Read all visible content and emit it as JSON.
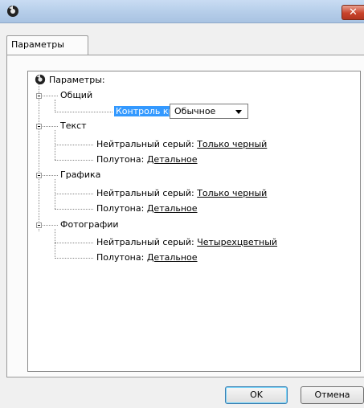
{
  "window": {
    "title": ""
  },
  "tabs": [
    {
      "label": "Параметры"
    }
  ],
  "tree": {
    "root": "Параметры:",
    "general": {
      "label": "Общий",
      "edge_control_label": "Контроль края:",
      "edge_control_value": "Обычное"
    },
    "text": {
      "label": "Текст",
      "neutral_label": "Нейтральный серый:",
      "neutral_value": "Только черный",
      "halftone_label": "Полутона:",
      "halftone_value": "Детальное"
    },
    "graphics": {
      "label": "Графика",
      "neutral_label": "Нейтральный серый:",
      "neutral_value": "Только черный",
      "halftone_label": "Полутона:",
      "halftone_value": "Детальное"
    },
    "photos": {
      "label": "Фотографии",
      "neutral_label": "Нейтральный серый:",
      "neutral_value": "Четырехцветный",
      "halftone_label": "Полутона:",
      "halftone_value": "Детальное"
    }
  },
  "buttons": {
    "ok": "OK",
    "cancel": "Отмена"
  },
  "icons": {
    "app": "printer-settings-icon",
    "close": "close-icon"
  }
}
